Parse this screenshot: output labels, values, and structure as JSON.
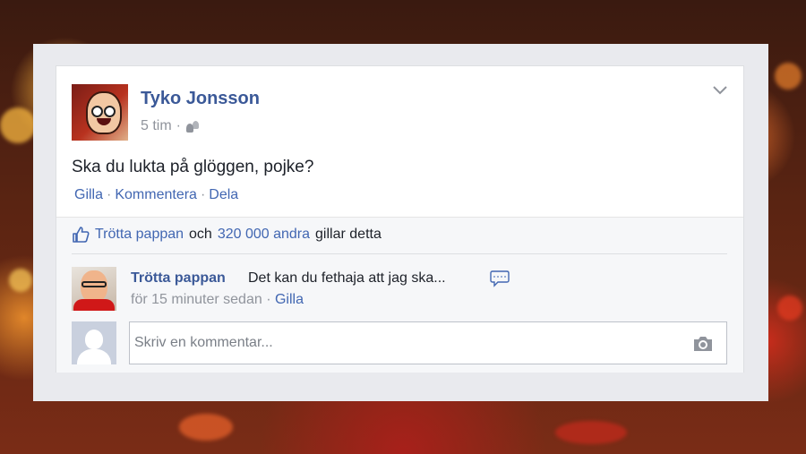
{
  "post": {
    "author": "Tyko Jonsson",
    "time": "5 tim",
    "meta_separator": "·",
    "text": "Ska du lukta på glöggen, pojke?",
    "actions": [
      "Gilla",
      "Kommentera",
      "Dela"
    ],
    "action_separator": "·"
  },
  "likes": {
    "first_liker": "Trötta pappan",
    "conjunction": "och",
    "others": "320 000 andra",
    "suffix": "gillar detta"
  },
  "comment": {
    "author": "Trötta pappan",
    "text": "Det kan du fethaja att jag ska...",
    "timestamp": "för 15 minuter sedan",
    "separator": "·",
    "like_label": "Gilla"
  },
  "composer": {
    "placeholder": "Skriv en kommentar..."
  },
  "icons": {
    "privacy": "friends-icon",
    "options": "chevron-down-icon",
    "like": "thumbs-up-icon",
    "emoticon": "speech-bubble-icon",
    "photo": "camera-icon"
  },
  "colors": {
    "link": "#3b5998",
    "action": "#4267b2",
    "text": "#1d2129",
    "muted": "#90949c"
  }
}
